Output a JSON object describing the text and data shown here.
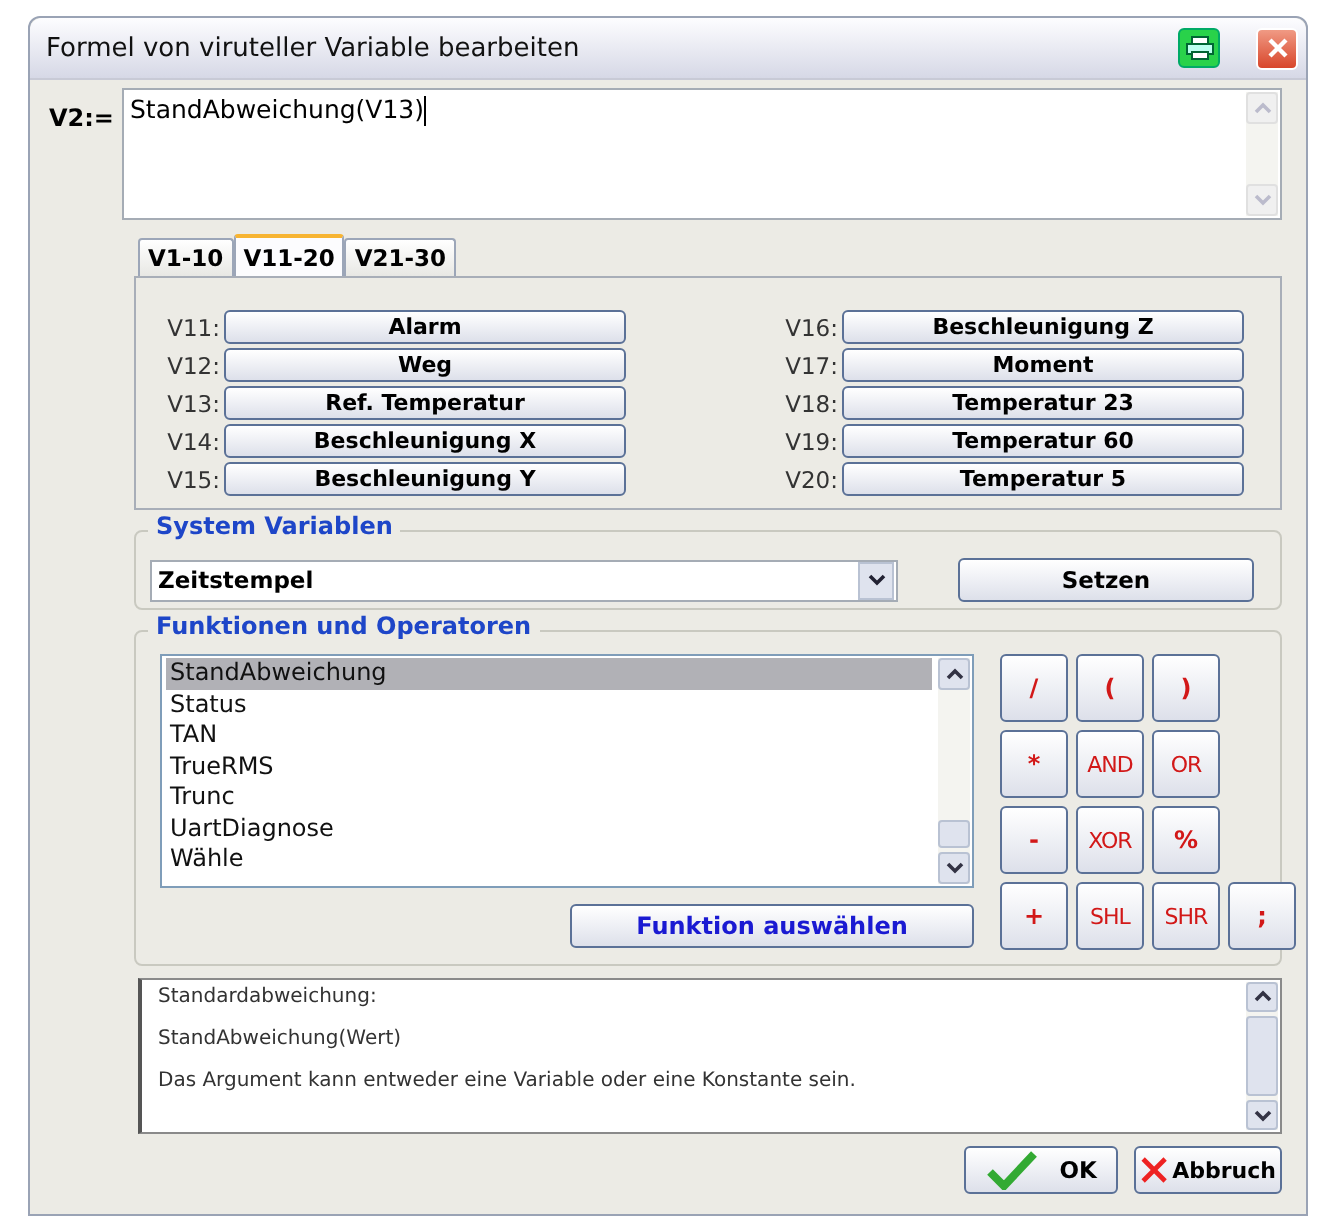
{
  "window": {
    "title": "Formel von viruteller Variable bearbeiten"
  },
  "formula": {
    "label": "V2:=",
    "value": "StandAbweichung(V13)"
  },
  "tabs": [
    {
      "label": "V1-10",
      "selected": false
    },
    {
      "label": "V11-20",
      "selected": true
    },
    {
      "label": "V21-30",
      "selected": false
    }
  ],
  "variables": [
    {
      "label": "V11:",
      "name": "Alarm"
    },
    {
      "label": "V12:",
      "name": "Weg"
    },
    {
      "label": "V13:",
      "name": "Ref. Temperatur"
    },
    {
      "label": "V14:",
      "name": "Beschleunigung X"
    },
    {
      "label": "V15:",
      "name": "Beschleunigung Y"
    },
    {
      "label": "V16:",
      "name": "Beschleunigung Z"
    },
    {
      "label": "V17:",
      "name": "Moment"
    },
    {
      "label": "V18:",
      "name": "Temperatur 23"
    },
    {
      "label": "V19:",
      "name": "Temperatur 60"
    },
    {
      "label": "V20:",
      "name": "Temperatur 5"
    }
  ],
  "system_variables": {
    "title": "System Variablen",
    "value": "Zeitstempel",
    "button": "Setzen"
  },
  "functions": {
    "title": "Funktionen und Operatoren",
    "items": [
      {
        "label": "StandAbweichung",
        "selected": true
      },
      {
        "label": "Status",
        "selected": false
      },
      {
        "label": "TAN",
        "selected": false
      },
      {
        "label": "TrueRMS",
        "selected": false
      },
      {
        "label": "Trunc",
        "selected": false
      },
      {
        "label": "UartDiagnose",
        "selected": false
      },
      {
        "label": "Wähle",
        "selected": false
      }
    ],
    "button": "Funktion auswählen",
    "operator_rows": [
      [
        {
          "label": "/",
          "kind": "symbol"
        },
        {
          "label": "(",
          "kind": "symbol"
        },
        {
          "label": ")",
          "kind": "symbol"
        }
      ],
      [
        {
          "label": "*",
          "kind": "symbol"
        },
        {
          "label": "AND",
          "kind": "word"
        },
        {
          "label": "OR",
          "kind": "word"
        }
      ],
      [
        {
          "label": "-",
          "kind": "symbol"
        },
        {
          "label": "XOR",
          "kind": "word"
        },
        {
          "label": "%",
          "kind": "symbol"
        }
      ],
      [
        {
          "label": "+",
          "kind": "symbol"
        },
        {
          "label": "SHL",
          "kind": "word"
        },
        {
          "label": "SHR",
          "kind": "word"
        },
        {
          "label": ";",
          "kind": "symbol"
        }
      ]
    ]
  },
  "description": [
    "Standardabweichung:",
    "StandAbweichung(Wert)",
    "Das Argument kann entweder eine Variable oder eine Konstante sein."
  ],
  "buttons": {
    "ok": "OK",
    "cancel": "Abbruch"
  }
}
